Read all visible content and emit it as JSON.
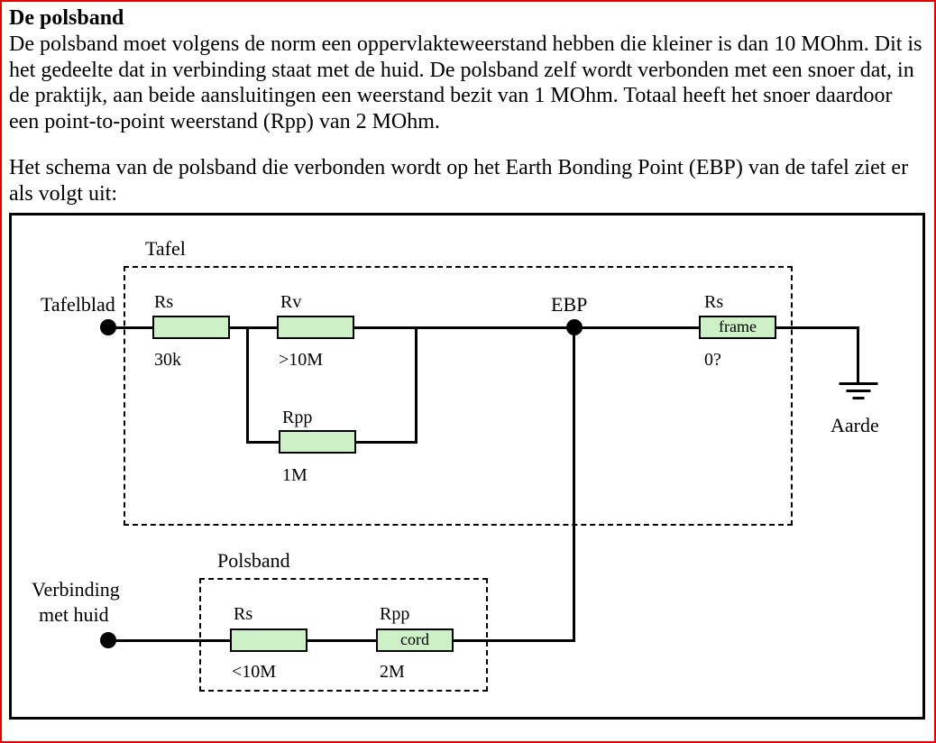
{
  "title": "De polsband",
  "para1": "De polsband moet volgens de norm een oppervlakteweerstand hebben die kleiner is dan 10 MOhm. Dit is het gedeelte dat in verbinding staat met de huid. De polsband zelf wordt verbonden met een snoer dat, in de praktijk, aan beide aansluitingen een weerstand bezit van 1 MOhm. Totaal heeft het snoer daardoor een point-to-point weerstand (Rpp) van 2 MOhm.",
  "para2": "Het schema van de polsband die verbonden wordt op het Earth Bonding Point (EBP) van de tafel ziet er als volgt uit:",
  "schematic": {
    "tafel_group_label": "Tafel",
    "tafelblad_label": "Tafelblad",
    "polsband_group_label": "Polsband",
    "verbinding_label_line1": "Verbinding",
    "verbinding_label_line2": "met  huid",
    "ebp_label": "EBP",
    "aarde_label": "Aarde",
    "r_tafel_rs": {
      "name": "Rs",
      "value": "30k"
    },
    "r_tafel_rv": {
      "name": "Rv",
      "value": ">10M"
    },
    "r_tafel_rpp": {
      "name": "Rpp",
      "value": "1M"
    },
    "r_frame": {
      "name": "Rs",
      "inner": "frame",
      "value": "0?"
    },
    "r_pols_rs": {
      "name": "Rs",
      "value": "<10M"
    },
    "r_pols_rpp": {
      "name": "Rpp",
      "inner": "cord",
      "value": "2M"
    }
  }
}
